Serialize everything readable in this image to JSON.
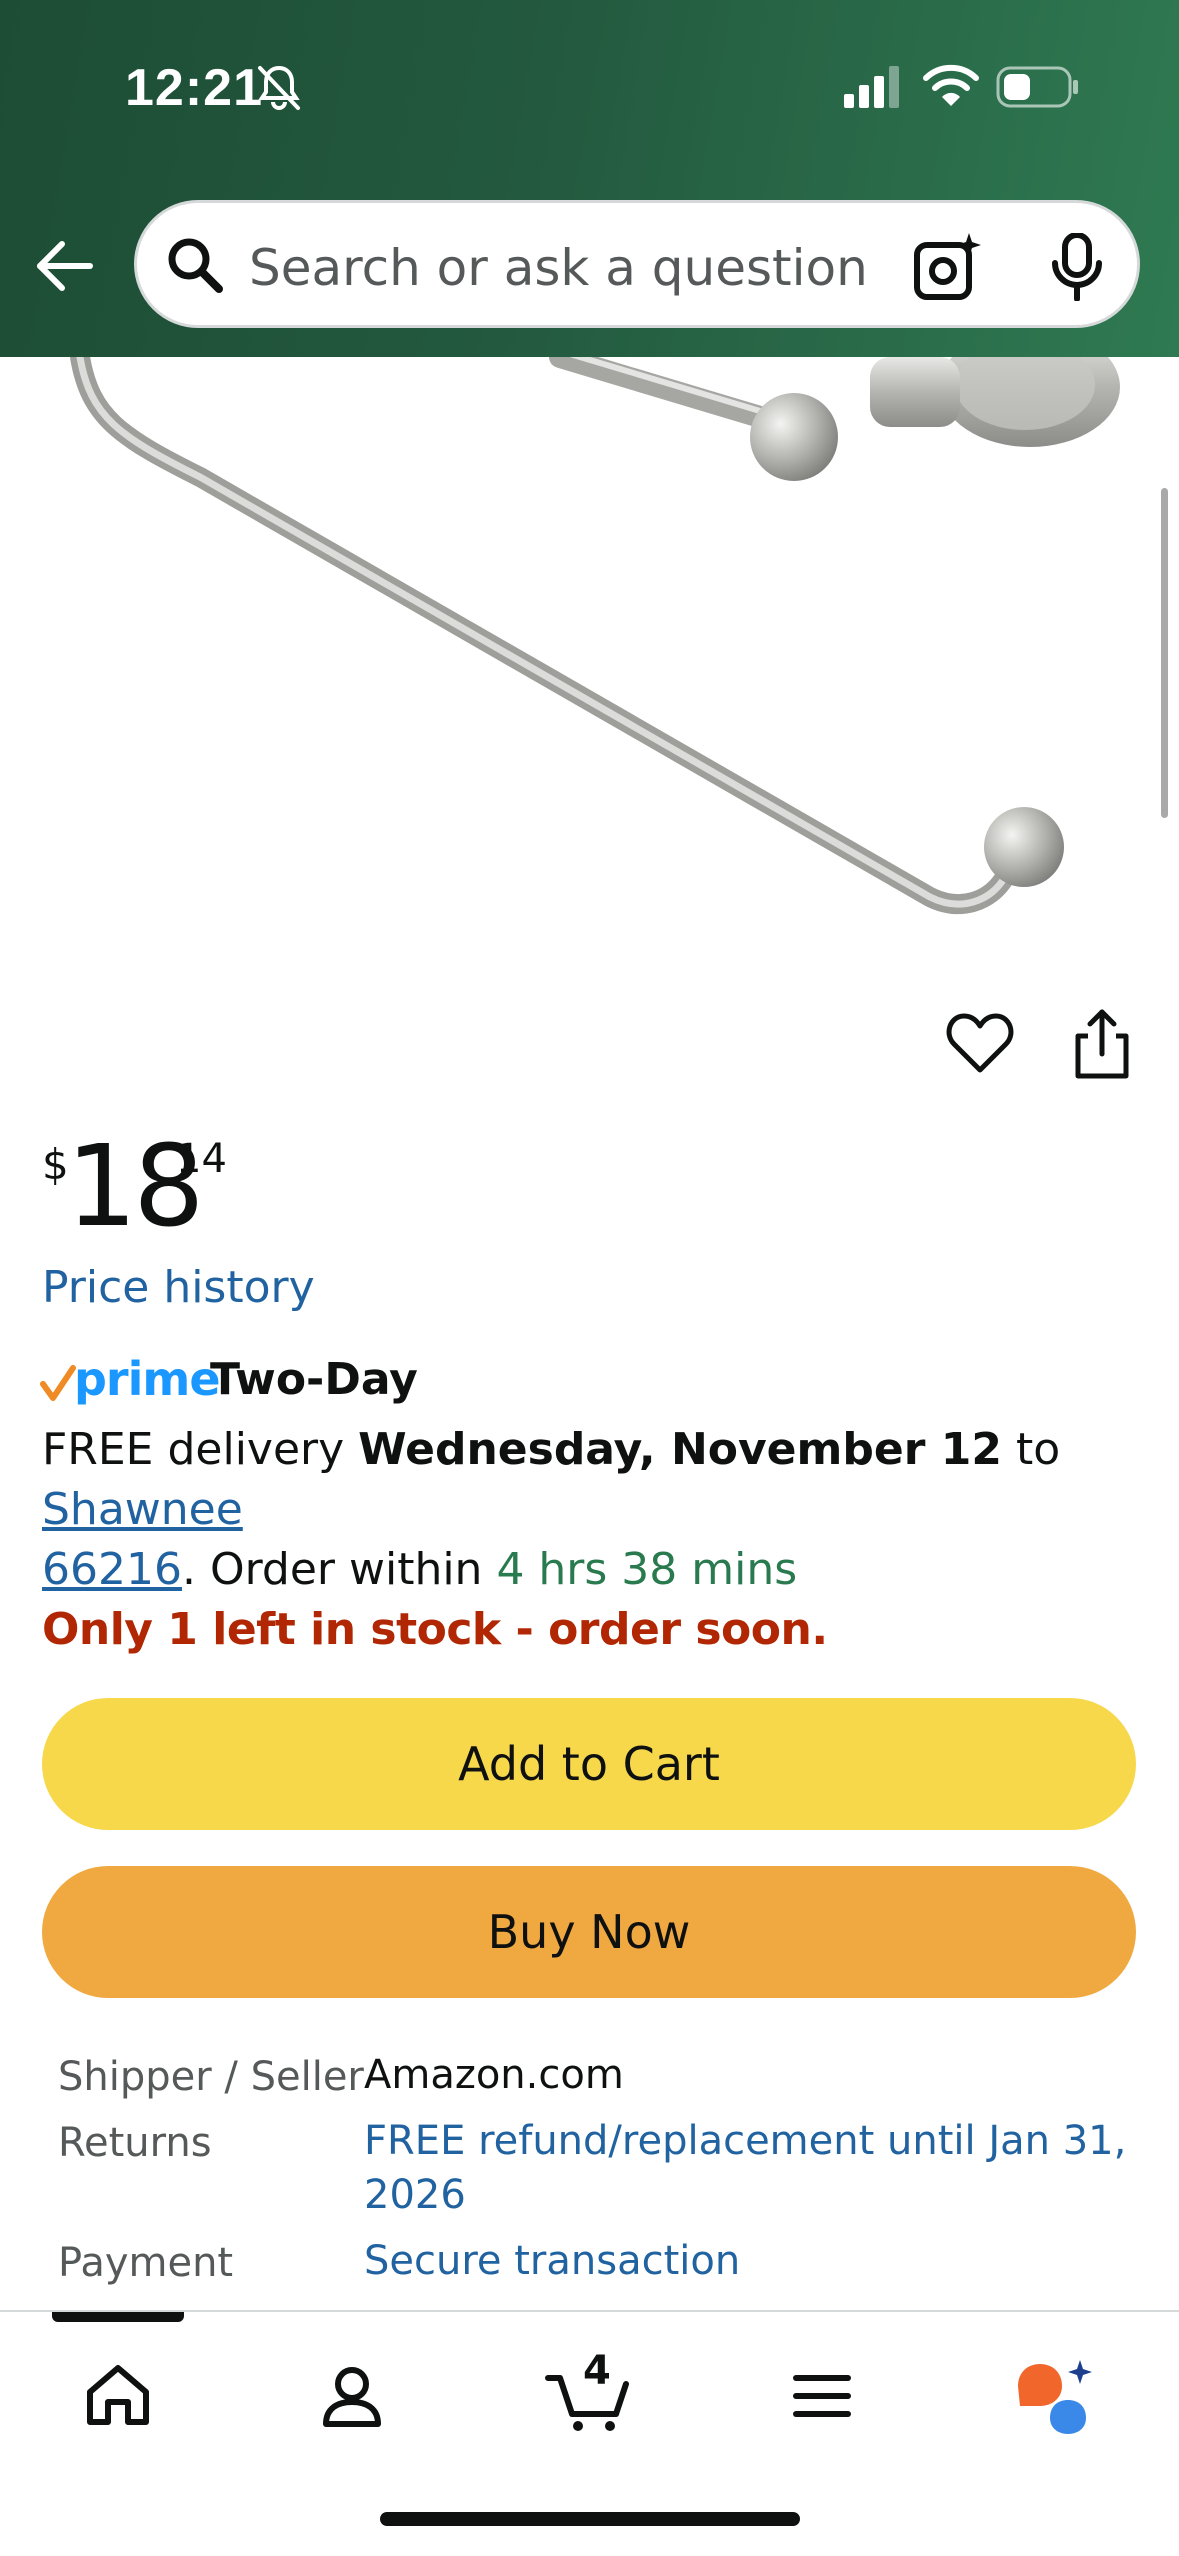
{
  "status_bar": {
    "time": "12:21"
  },
  "search": {
    "placeholder": "Search or ask a question"
  },
  "price": {
    "symbol": "$",
    "whole": "18",
    "fraction": "14"
  },
  "price_history_label": "Price history",
  "delivery": {
    "prime_label": "prime",
    "speed_label": "Two-Day",
    "free_text": "FREE delivery ",
    "date": "Wednesday, November 12",
    "to_text": " to ",
    "location_line1": "Shawnee",
    "location_line2": "66216",
    "order_within_text": ". Order within ",
    "countdown": "4 hrs 38 mins"
  },
  "stock_message": "Only 1 left in stock - order soon.",
  "buttons": {
    "add_to_cart": "Add to Cart",
    "buy_now": "Buy Now"
  },
  "info": {
    "rows": [
      {
        "label": "Shipper / Seller",
        "value": "Amazon.com"
      },
      {
        "label": "Returns",
        "value": "FREE refund/replacement until Jan 31, 2026"
      },
      {
        "label": "Payment",
        "value": "Secure transaction"
      }
    ]
  },
  "bottom_nav": {
    "cart_count": "4",
    "items": [
      "home-icon",
      "account-icon",
      "cart-icon",
      "menu-icon",
      "rufus-ai-icon"
    ]
  },
  "colors": {
    "header_green": "#23593f",
    "link_blue": "#2162a1",
    "prime_blue": "#1a98ff",
    "stock_red": "#b12704",
    "add_to_cart_yellow": "#f7d84a",
    "buy_now_orange": "#f0a941",
    "countdown_green": "#2a7a4f"
  }
}
